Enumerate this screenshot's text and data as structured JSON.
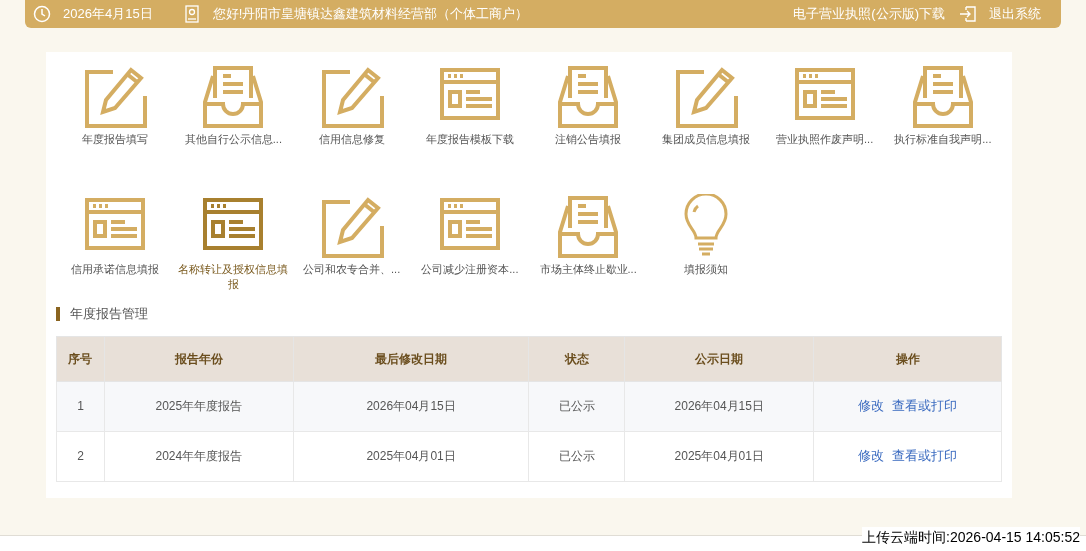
{
  "top_bar": {
    "date": "2026年4月15日",
    "greeting": "您好!丹阳市皇塘镇达鑫建筑材料经营部（个体工商户）",
    "license_link": "电子营业执照(公示版)下载",
    "logout": "退出系统"
  },
  "shortcuts": [
    {
      "kind": "edit",
      "label": "年度报告填写",
      "selected": false
    },
    {
      "kind": "inbox",
      "label": "其他自行公示信息...",
      "selected": false
    },
    {
      "kind": "edit",
      "label": "信用信息修复",
      "selected": false
    },
    {
      "kind": "browser",
      "label": "年度报告模板下载",
      "selected": false
    },
    {
      "kind": "inbox",
      "label": "注销公告填报",
      "selected": false
    },
    {
      "kind": "edit",
      "label": "集团成员信息填报",
      "selected": false
    },
    {
      "kind": "browser",
      "label": "营业执照作废声明...",
      "selected": false
    },
    {
      "kind": "inbox",
      "label": "执行标准自我声明...",
      "selected": false
    },
    {
      "kind": "browser",
      "label": "信用承诺信息填报",
      "selected": false
    },
    {
      "kind": "browser",
      "label": "名称转让及授权信息填报",
      "selected": true
    },
    {
      "kind": "edit",
      "label": "公司和农专合并、...",
      "selected": false
    },
    {
      "kind": "browser",
      "label": "公司减少注册资本...",
      "selected": false
    },
    {
      "kind": "inbox",
      "label": "市场主体终止歇业...",
      "selected": false
    },
    {
      "kind": "bulb",
      "label": "填报须知",
      "selected": false
    }
  ],
  "section_title": "年度报告管理",
  "table": {
    "columns": [
      "序号",
      "报告年份",
      "最后修改日期",
      "状态",
      "公示日期",
      "操作"
    ],
    "rows": [
      {
        "cells": [
          "1",
          "2025年年度报告",
          "2026年04月15日",
          "已公示",
          "2026年04月15日"
        ],
        "actions": [
          "修改",
          "查看或打印"
        ]
      },
      {
        "cells": [
          "2",
          "2024年年度报告",
          "2025年04月01日",
          "已公示",
          "2025年04月01日"
        ],
        "actions": [
          "修改",
          "查看或打印"
        ]
      }
    ]
  },
  "upload_time": "上传云端时间:2026-04-15 14:05:52"
}
